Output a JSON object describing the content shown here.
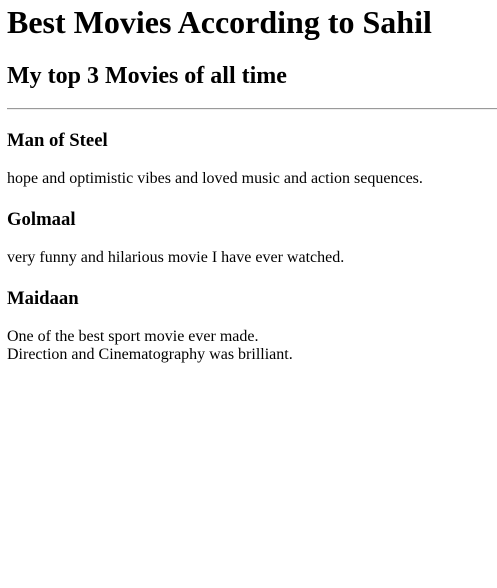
{
  "header": {
    "title": "Best Movies According to Sahil",
    "subtitle": "My top 3 Movies of all time"
  },
  "movies": [
    {
      "title": "Man of Steel",
      "description_lines": [
        "hope and optimistic vibes and loved music and action sequences."
      ]
    },
    {
      "title": "Golmaal",
      "description_lines": [
        "very funny and hilarious movie I have ever watched."
      ]
    },
    {
      "title": "Maidaan",
      "description_lines": [
        "One of the best sport movie ever made.",
        "Direction and Cinematography was brilliant."
      ]
    }
  ]
}
